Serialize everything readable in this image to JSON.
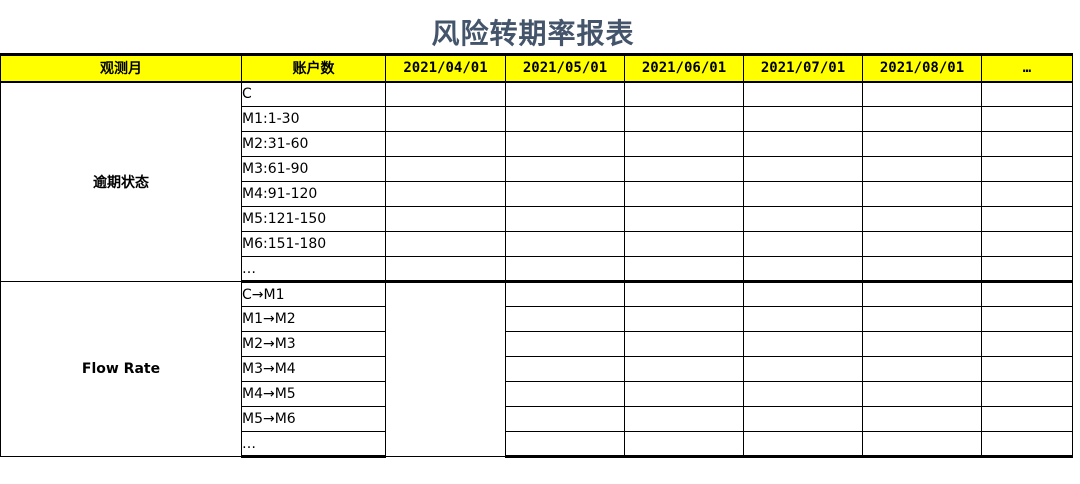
{
  "title": "风险转期率报表",
  "headers": {
    "observe_month": "观测月",
    "account_count": "账户数",
    "dates": [
      "2021/04/01",
      "2021/05/01",
      "2021/06/01",
      "2021/07/01",
      "2021/08/01",
      "…"
    ]
  },
  "sections": [
    {
      "label": "逾期状态",
      "rows": [
        "C",
        "M1:1-30",
        "M2:31-60",
        "M3:61-90",
        "M4:91-120",
        "M5:121-150",
        "M6:151-180",
        "…"
      ]
    },
    {
      "label": "Flow Rate",
      "rows": [
        "C→M1",
        "M1→M2",
        "M2→M3",
        "M3→M4",
        "M4→M5",
        "M5→M6",
        "…"
      ]
    }
  ]
}
